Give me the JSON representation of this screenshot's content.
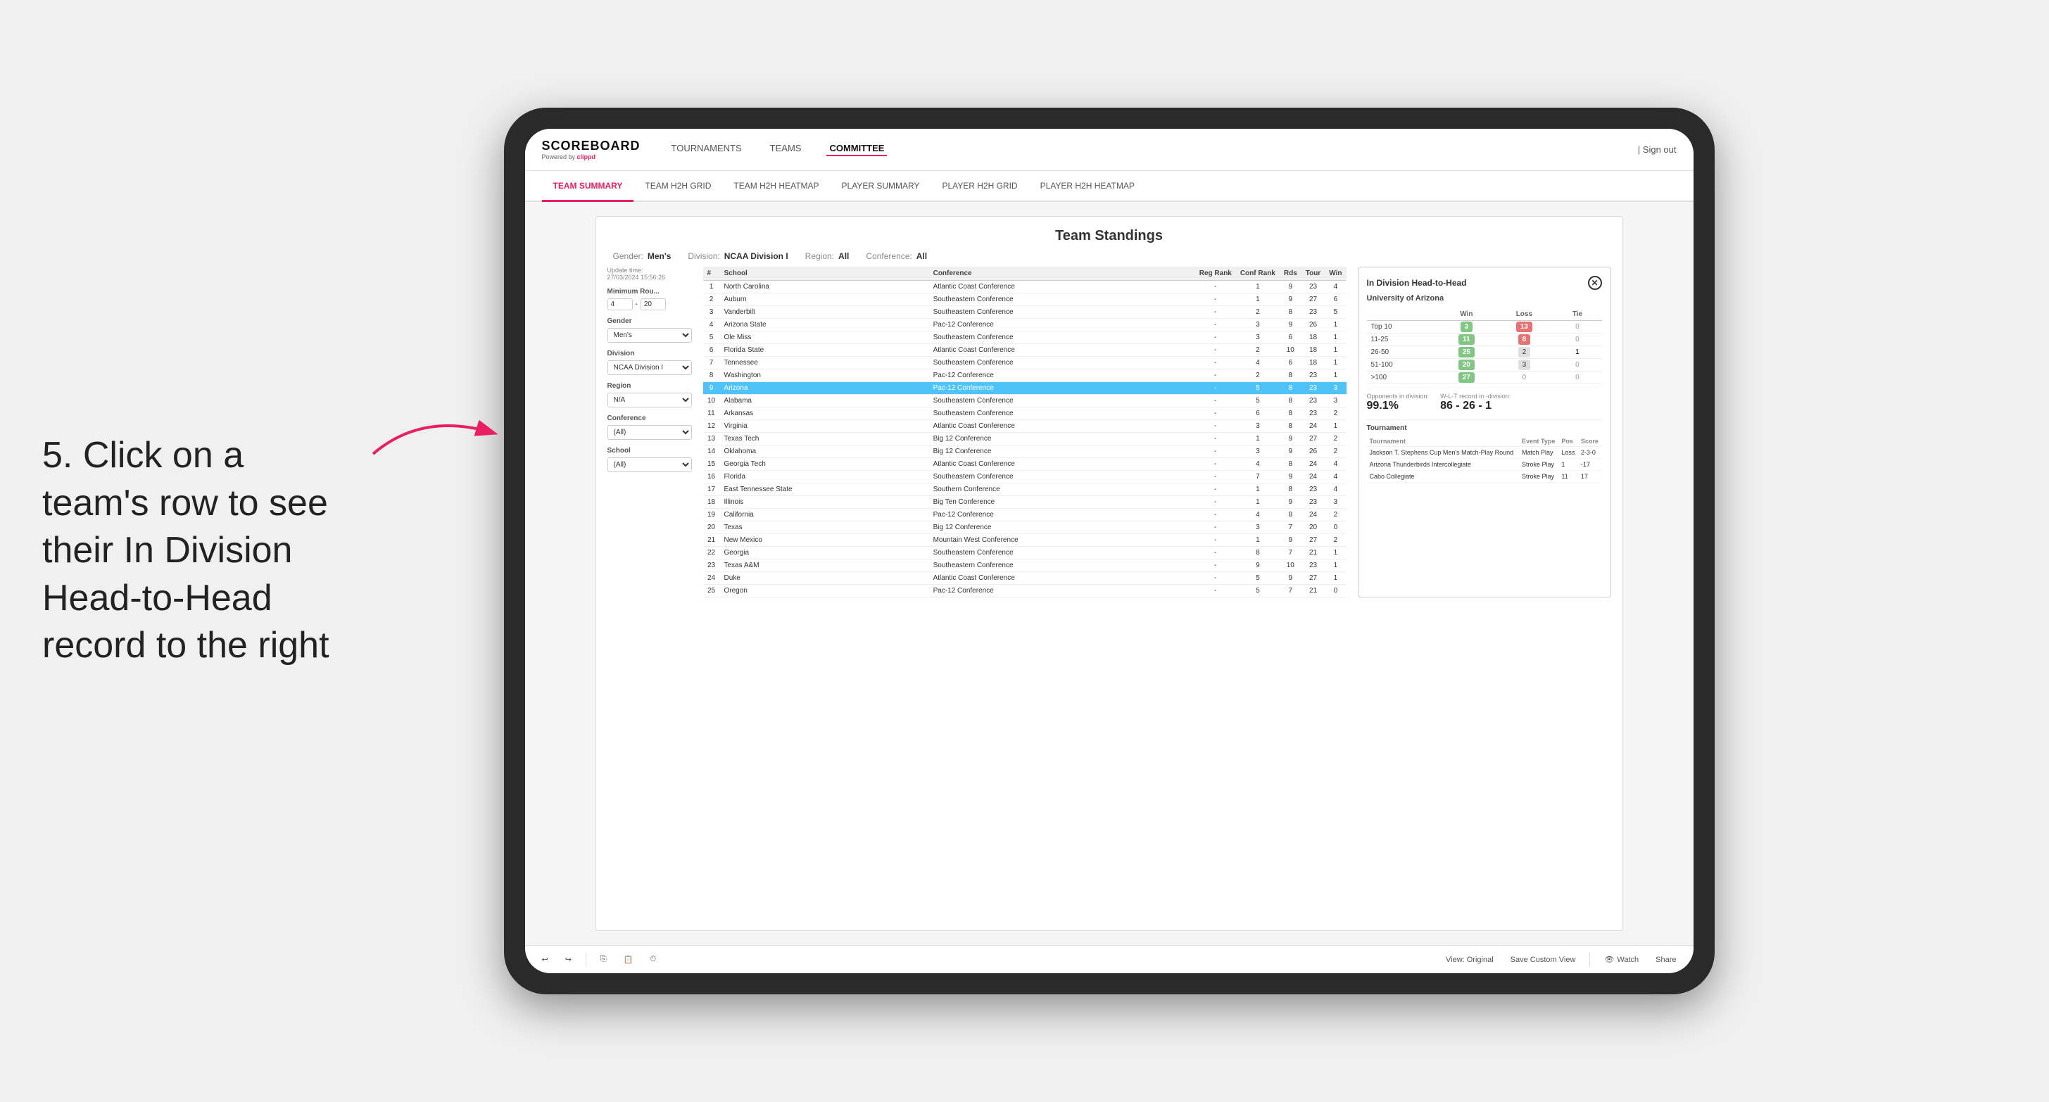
{
  "page": {
    "bg_color": "#e8e8e8"
  },
  "instruction": {
    "text": "5. Click on a team's row to see their In Division Head-to-Head record to the right"
  },
  "nav": {
    "logo": "SCOREBOARD",
    "logo_sub": "Powered by ",
    "logo_brand": "clippd",
    "links": [
      "TOURNAMENTS",
      "TEAMS",
      "COMMITTEE"
    ],
    "active_link": "COMMITTEE",
    "sign_out": "Sign out"
  },
  "sub_nav": {
    "links": [
      "TEAM SUMMARY",
      "TEAM H2H GRID",
      "TEAM H2H HEATMAP",
      "PLAYER SUMMARY",
      "PLAYER H2H GRID",
      "PLAYER H2H HEATMAP"
    ],
    "active": "PLAYER SUMMARY"
  },
  "content": {
    "update_time_label": "Update time:",
    "update_time": "27/03/2024 15:56:26",
    "title": "Team Standings",
    "filters": {
      "gender_label": "Gender:",
      "gender_value": "Men's",
      "division_label": "Division:",
      "division_value": "NCAA Division I",
      "region_label": "Region:",
      "region_value": "All",
      "conference_label": "Conference:",
      "conference_value": "All"
    },
    "sidebar": {
      "min_rounds_label": "Minimum Rou...",
      "min_rounds_val1": "4",
      "min_rounds_val2": "20",
      "gender_label": "Gender",
      "gender_val": "Men's",
      "division_label": "Division",
      "division_val": "NCAA Division I",
      "region_label": "Region",
      "region_val": "N/A",
      "conference_label": "Conference",
      "conference_val": "(All)",
      "school_label": "School",
      "school_val": "(All)"
    },
    "table": {
      "headers": [
        "#",
        "School",
        "Conference",
        "Reg Rank",
        "Conf Rank",
        "Rds",
        "Tour",
        "Win"
      ],
      "rows": [
        {
          "rank": "1",
          "school": "North Carolina",
          "conference": "Atlantic Coast Conference",
          "reg_rank": "-",
          "conf_rank": "1",
          "rds": "9",
          "tour": "23",
          "win": "4"
        },
        {
          "rank": "2",
          "school": "Auburn",
          "conference": "Southeastern Conference",
          "reg_rank": "-",
          "conf_rank": "1",
          "rds": "9",
          "tour": "27",
          "win": "6"
        },
        {
          "rank": "3",
          "school": "Vanderbilt",
          "conference": "Southeastern Conference",
          "reg_rank": "-",
          "conf_rank": "2",
          "rds": "8",
          "tour": "23",
          "win": "5"
        },
        {
          "rank": "4",
          "school": "Arizona State",
          "conference": "Pac-12 Conference",
          "reg_rank": "-",
          "conf_rank": "3",
          "rds": "9",
          "tour": "26",
          "win": "1"
        },
        {
          "rank": "5",
          "school": "Ole Miss",
          "conference": "Southeastern Conference",
          "reg_rank": "-",
          "conf_rank": "3",
          "rds": "6",
          "tour": "18",
          "win": "1"
        },
        {
          "rank": "6",
          "school": "Florida State",
          "conference": "Atlantic Coast Conference",
          "reg_rank": "-",
          "conf_rank": "2",
          "rds": "10",
          "tour": "18",
          "win": "1"
        },
        {
          "rank": "7",
          "school": "Tennessee",
          "conference": "Southeastern Conference",
          "reg_rank": "-",
          "conf_rank": "4",
          "rds": "6",
          "tour": "18",
          "win": "1"
        },
        {
          "rank": "8",
          "school": "Washington",
          "conference": "Pac-12 Conference",
          "reg_rank": "-",
          "conf_rank": "2",
          "rds": "8",
          "tour": "23",
          "win": "1"
        },
        {
          "rank": "9",
          "school": "Arizona",
          "conference": "Pac-12 Conference",
          "reg_rank": "-",
          "conf_rank": "5",
          "rds": "8",
          "tour": "23",
          "win": "3",
          "highlighted": true
        },
        {
          "rank": "10",
          "school": "Alabama",
          "conference": "Southeastern Conference",
          "reg_rank": "-",
          "conf_rank": "5",
          "rds": "8",
          "tour": "23",
          "win": "3"
        },
        {
          "rank": "11",
          "school": "Arkansas",
          "conference": "Southeastern Conference",
          "reg_rank": "-",
          "conf_rank": "6",
          "rds": "8",
          "tour": "23",
          "win": "2"
        },
        {
          "rank": "12",
          "school": "Virginia",
          "conference": "Atlantic Coast Conference",
          "reg_rank": "-",
          "conf_rank": "3",
          "rds": "8",
          "tour": "24",
          "win": "1"
        },
        {
          "rank": "13",
          "school": "Texas Tech",
          "conference": "Big 12 Conference",
          "reg_rank": "-",
          "conf_rank": "1",
          "rds": "9",
          "tour": "27",
          "win": "2"
        },
        {
          "rank": "14",
          "school": "Oklahoma",
          "conference": "Big 12 Conference",
          "reg_rank": "-",
          "conf_rank": "3",
          "rds": "9",
          "tour": "26",
          "win": "2"
        },
        {
          "rank": "15",
          "school": "Georgia Tech",
          "conference": "Atlantic Coast Conference",
          "reg_rank": "-",
          "conf_rank": "4",
          "rds": "8",
          "tour": "24",
          "win": "4"
        },
        {
          "rank": "16",
          "school": "Florida",
          "conference": "Southeastern Conference",
          "reg_rank": "-",
          "conf_rank": "7",
          "rds": "9",
          "tour": "24",
          "win": "4"
        },
        {
          "rank": "17",
          "school": "East Tennessee State",
          "conference": "Southern Conference",
          "reg_rank": "-",
          "conf_rank": "1",
          "rds": "8",
          "tour": "23",
          "win": "4"
        },
        {
          "rank": "18",
          "school": "Illinois",
          "conference": "Big Ten Conference",
          "reg_rank": "-",
          "conf_rank": "1",
          "rds": "9",
          "tour": "23",
          "win": "3"
        },
        {
          "rank": "19",
          "school": "California",
          "conference": "Pac-12 Conference",
          "reg_rank": "-",
          "conf_rank": "4",
          "rds": "8",
          "tour": "24",
          "win": "2"
        },
        {
          "rank": "20",
          "school": "Texas",
          "conference": "Big 12 Conference",
          "reg_rank": "-",
          "conf_rank": "3",
          "rds": "7",
          "tour": "20",
          "win": "0"
        },
        {
          "rank": "21",
          "school": "New Mexico",
          "conference": "Mountain West Conference",
          "reg_rank": "-",
          "conf_rank": "1",
          "rds": "9",
          "tour": "27",
          "win": "2"
        },
        {
          "rank": "22",
          "school": "Georgia",
          "conference": "Southeastern Conference",
          "reg_rank": "-",
          "conf_rank": "8",
          "rds": "7",
          "tour": "21",
          "win": "1"
        },
        {
          "rank": "23",
          "school": "Texas A&M",
          "conference": "Southeastern Conference",
          "reg_rank": "-",
          "conf_rank": "9",
          "rds": "10",
          "tour": "23",
          "win": "1"
        },
        {
          "rank": "24",
          "school": "Duke",
          "conference": "Atlantic Coast Conference",
          "reg_rank": "-",
          "conf_rank": "5",
          "rds": "9",
          "tour": "27",
          "win": "1"
        },
        {
          "rank": "25",
          "school": "Oregon",
          "conference": "Pac-12 Conference",
          "reg_rank": "-",
          "conf_rank": "5",
          "rds": "7",
          "tour": "21",
          "win": "0"
        }
      ]
    },
    "h2h": {
      "title": "In Division Head-to-Head",
      "team": "University of Arizona",
      "grid_headers": [
        "",
        "Win",
        "Loss",
        "Tie"
      ],
      "grid_rows": [
        {
          "label": "Top 10",
          "win": "3",
          "loss": "13",
          "tie": "0",
          "win_color": "green",
          "loss_color": "red"
        },
        {
          "label": "11-25",
          "win": "11",
          "loss": "8",
          "tie": "0",
          "win_color": "green",
          "loss_color": "red"
        },
        {
          "label": "26-50",
          "win": "25",
          "loss": "2",
          "tie": "1",
          "win_color": "green",
          "loss_color": "gray"
        },
        {
          "label": "51-100",
          "win": "20",
          "loss": "3",
          "tie": "0",
          "win_color": "green",
          "loss_color": "gray"
        },
        {
          "label": ">100",
          "win": "27",
          "loss": "0",
          "tie": "0",
          "win_color": "green",
          "loss_color": "zero"
        }
      ],
      "opponents_label": "Opponents in division:",
      "opponents_value": "99.1%",
      "record_label": "W-L-T record in -division:",
      "record_value": "86 - 26 - 1",
      "tournaments_label": "Tournament",
      "tournament_headers": [
        "Tournament",
        "Event Type",
        "Pos",
        "Score"
      ],
      "tournament_rows": [
        {
          "name": "Jackson T. Stephens Cup Men's Match-Play Round",
          "event_type": "Match Play",
          "pos": "Loss",
          "score": "2-3-0"
        },
        {
          "spacer": "1"
        },
        {
          "name": "Arizona Thunderbirds Intercollegiate",
          "event_type": "Stroke Play",
          "pos": "1",
          "score": "-17"
        },
        {
          "spacer": "1"
        },
        {
          "name": "Cabo Collegiate",
          "event_type": "Stroke Play",
          "pos": "11",
          "score": "17"
        }
      ]
    }
  },
  "toolbar": {
    "undo": "↩",
    "redo": "↪",
    "view_original": "View: Original",
    "save_custom": "Save Custom View",
    "watch": "Watch",
    "share": "Share"
  }
}
